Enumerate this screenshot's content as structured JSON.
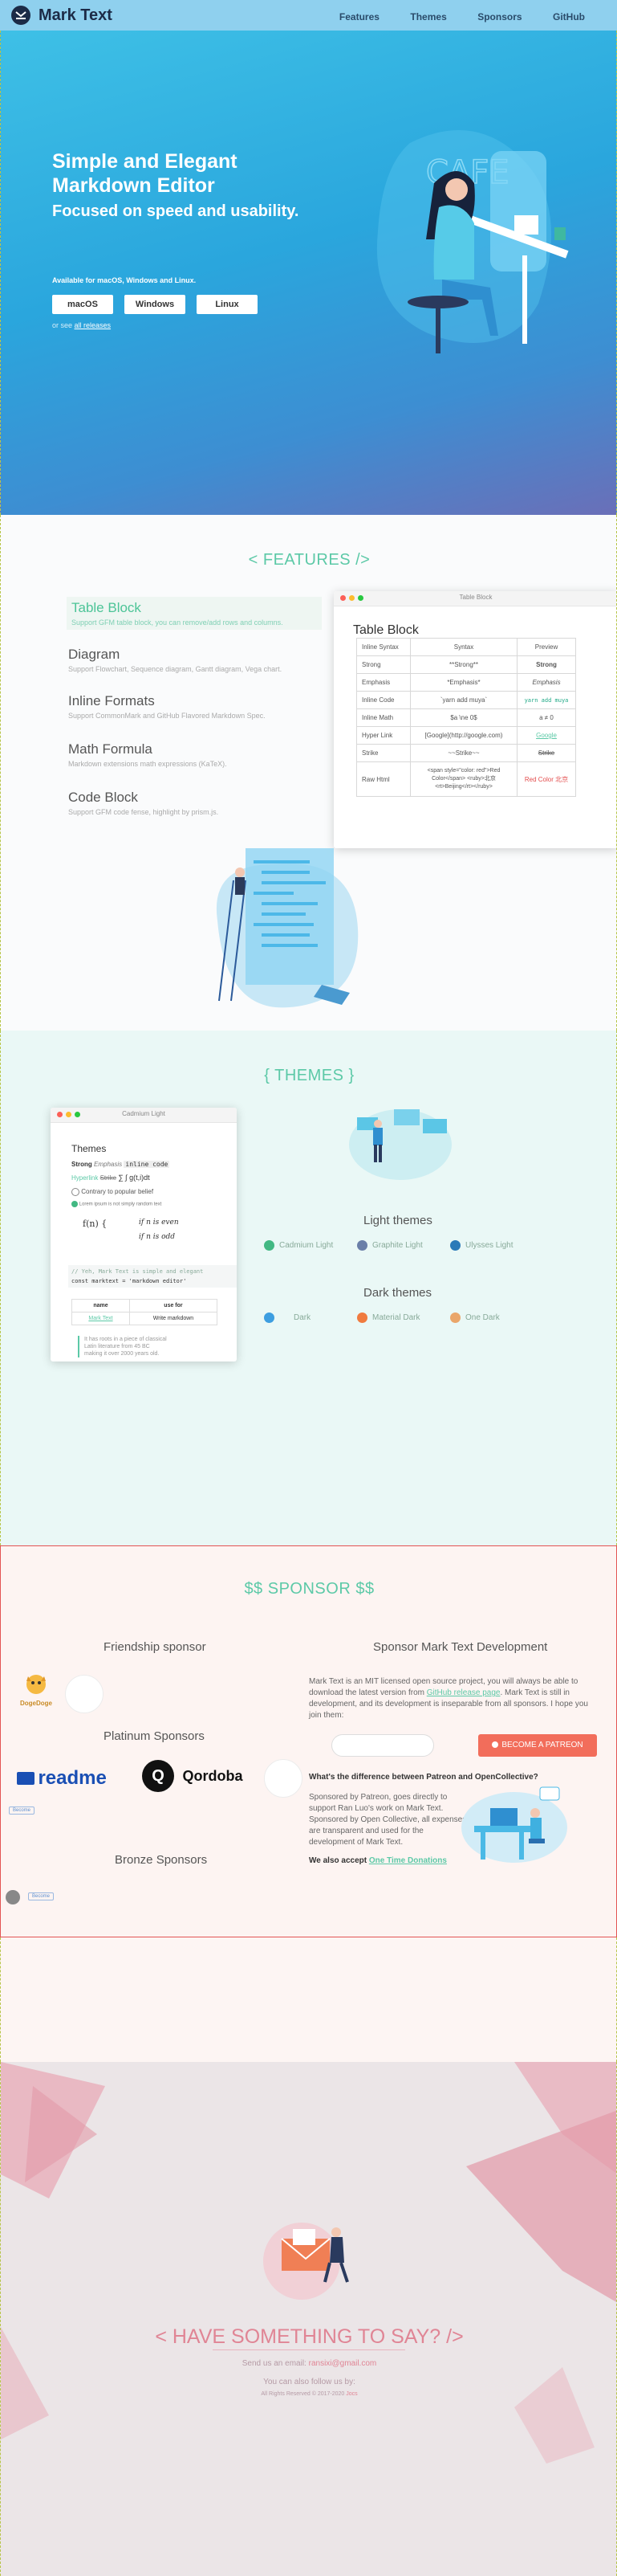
{
  "nav": {
    "brand": "Mark Text",
    "links": [
      "Features",
      "Themes",
      "Sponsors",
      "GitHub"
    ]
  },
  "hero": {
    "title": "Simple and Elegant Markdown Editor",
    "subtitle": "Focused on speed and usability.",
    "available": "Available for macOS, Windows and Linux.",
    "buttons": [
      "macOS",
      "Windows",
      "Linux"
    ],
    "or_prefix": "or see",
    "or_link": "all releases",
    "illustration_sign": "CAFE"
  },
  "features": {
    "title": "< FEATURES />",
    "items": [
      {
        "title": "Table Block",
        "desc": "Support GFM table block, you can remove/add rows and columns."
      },
      {
        "title": "Diagram",
        "desc": "Support Flowchart, Sequence diagram, Gantt diagram, Vega chart."
      },
      {
        "title": "Inline Formats",
        "desc": "Support CommonMark and GitHub Flavored Markdown Spec."
      },
      {
        "title": "Math Formula",
        "desc": "Markdown extensions math expressions (KaTeX)."
      },
      {
        "title": "Code Block",
        "desc": "Support GFM code fense, highlight by prism.js."
      }
    ],
    "window_title": "Table Block",
    "table_heading": "Table Block",
    "table": [
      [
        "Inline Syntax",
        "Syntax",
        "Preview"
      ],
      [
        "Strong",
        "**Strong**",
        "Strong"
      ],
      [
        "Emphasis",
        "*Emphasis*",
        "Emphasis"
      ],
      [
        "Inline Code",
        "`yarn add muya`",
        "yarn add muya"
      ],
      [
        "Inline Math",
        "$a \\ne 0$",
        "a ≠ 0"
      ],
      [
        "Hyper Link",
        "[Google](http://google.com)",
        "Google"
      ],
      [
        "Strike",
        "~~Strike~~",
        "Strike"
      ],
      [
        "Raw Html",
        "<span style=\"color: red\">Red Color</span> <ruby>北京<rt>Beijing</rt></ruby>",
        "Red Color 北京"
      ]
    ]
  },
  "themes": {
    "title": "{ THEMES }",
    "window_title": "Cadmium Light",
    "preview": {
      "heading": "Themes",
      "strong": "Strong",
      "emphasis": "Emphasis",
      "code": "inline code",
      "link": "Hyperlink",
      "strike": "Strike",
      "todo1": "Contrary to popular belief",
      "todo2": "Lorem ipsum is not simply random text",
      "formula_if": "if n is even",
      "formula_odd": "if n is odd",
      "comment": "// Yeh, Mark Text is simple and elegant",
      "code_line": "const marktext = 'markdown editor'",
      "th1": "name",
      "th2": "use for",
      "td1": "Mark Text",
      "td2": "Write markdown",
      "quote1": "It has roots in a piece of classical",
      "quote2": "Latin literature from 45 BC",
      "quote3": "making it over 2000 years old."
    },
    "light_title": "Light themes",
    "light": [
      {
        "name": "Cadmium Light",
        "color": "#42b883"
      },
      {
        "name": "Graphite Light",
        "color": "#6a7fa8"
      },
      {
        "name": "Ulysses Light",
        "color": "#2a7ab8"
      }
    ],
    "dark_title": "Dark themes",
    "dark": [
      {
        "name": "Dark",
        "color": "#3d9ee0"
      },
      {
        "name": "Material Dark",
        "color": "#f07b3f"
      },
      {
        "name": "One Dark",
        "color": "#eaa66a"
      }
    ]
  },
  "sponsor": {
    "title": "$$ SPONSOR $$",
    "friendship": "Friendship sponsor",
    "doge": "DogeDoge",
    "platinum": "Platinum Sponsors",
    "readme": "readme",
    "qordoba": "Qordoba",
    "bronze": "Bronze Sponsors",
    "small_badge": "Become",
    "bronze_badge": "Become",
    "dev_title": "Sponsor Mark Text Development",
    "dev_text_1": "Mark Text is an MIT licensed open source project, you will always be able to download the latest version from",
    "dev_link": "GitHub release page",
    "dev_text_2": ". Mark Text is still in development, and its development is inseparable from all sponsors. I hope you join them:",
    "patreon": "BECOME A PATREON",
    "diff_title": "What's the difference between Patreon and OpenCollective?",
    "diff_text": "Sponsored by Patreon, goes directly to support Ran Luo's work on Mark Text. Sponsored by Open Collective, all expenses are transparent and used for the development of Mark Text.",
    "accept": "We also accept",
    "one_time": "One Time Donations"
  },
  "footer": {
    "say": "< HAVE SOMETHING TO SAY? />",
    "email_label": "Send us an email:",
    "email": "ransixi@gmail.com",
    "follow": "You can also follow us by:",
    "copyright": "All Rights Reserved © 2017-2020",
    "author": "Jocs"
  },
  "colors": {
    "accent": "#5cc9a7",
    "nav_bg": "#8fd0ee",
    "patreon": "#f26d5b",
    "footer_pink": "#e08595"
  }
}
